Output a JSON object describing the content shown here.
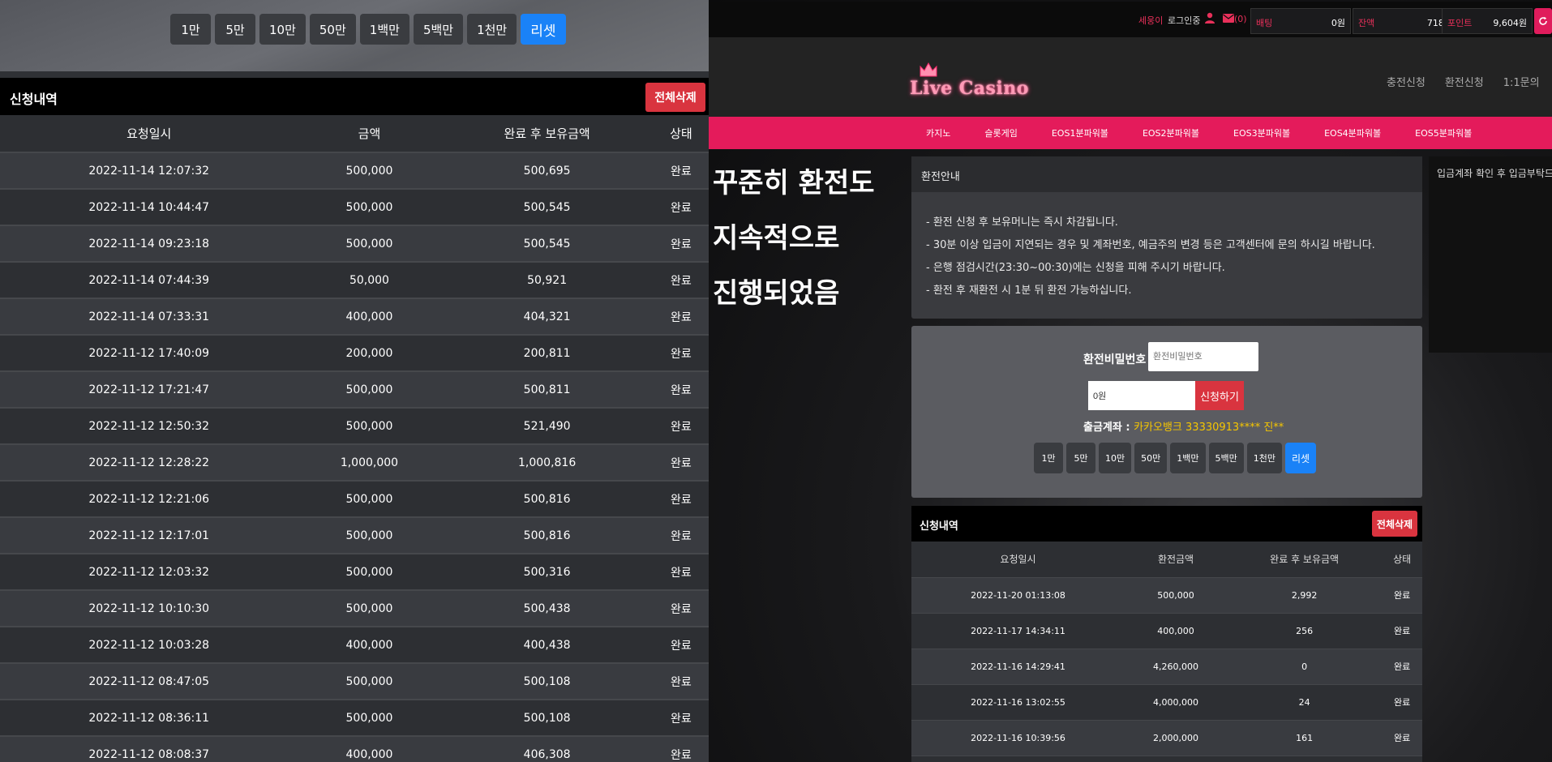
{
  "left": {
    "chips": [
      "1만",
      "5만",
      "10만",
      "50만",
      "1백만",
      "5백만",
      "1천만"
    ],
    "reset_label": "리셋",
    "history_title": "신청내역",
    "delete_all_label": "전체삭제",
    "columns": [
      "요청일시",
      "금액",
      "완료 후 보유금액",
      "상태"
    ],
    "rows": [
      [
        "2022-11-14 12:07:32",
        "500,000",
        "500,695",
        "완료"
      ],
      [
        "2022-11-14 10:44:47",
        "500,000",
        "500,545",
        "완료"
      ],
      [
        "2022-11-14 09:23:18",
        "500,000",
        "500,545",
        "완료"
      ],
      [
        "2022-11-14 07:44:39",
        "50,000",
        "50,921",
        "완료"
      ],
      [
        "2022-11-14 07:33:31",
        "400,000",
        "404,321",
        "완료"
      ],
      [
        "2022-11-12 17:40:09",
        "200,000",
        "200,811",
        "완료"
      ],
      [
        "2022-11-12 17:21:47",
        "500,000",
        "500,811",
        "완료"
      ],
      [
        "2022-11-12 12:50:32",
        "500,000",
        "521,490",
        "완료"
      ],
      [
        "2022-11-12 12:28:22",
        "1,000,000",
        "1,000,816",
        "완료"
      ],
      [
        "2022-11-12 12:21:06",
        "500,000",
        "500,816",
        "완료"
      ],
      [
        "2022-11-12 12:17:01",
        "500,000",
        "500,816",
        "완료"
      ],
      [
        "2022-11-12 12:03:32",
        "500,000",
        "500,316",
        "완료"
      ],
      [
        "2022-11-12 10:10:30",
        "500,000",
        "500,438",
        "완료"
      ],
      [
        "2022-11-12 10:03:28",
        "400,000",
        "400,438",
        "완료"
      ],
      [
        "2022-11-12 08:47:05",
        "500,000",
        "500,108",
        "완료"
      ],
      [
        "2022-11-12 08:36:11",
        "500,000",
        "500,108",
        "완료"
      ],
      [
        "2022-11-12 08:08:37",
        "400,000",
        "406,308",
        "완료"
      ]
    ]
  },
  "right": {
    "user": {
      "name": "세웅이",
      "login_label": "로그인중",
      "mail_count": "(0)"
    },
    "stats": [
      {
        "label": "배팅",
        "value": "0원"
      },
      {
        "label": "잔액",
        "value": "718원"
      },
      {
        "label": "포인트",
        "value": "9,604원"
      }
    ],
    "logo_text": "Live Casino",
    "header_links": [
      "충전신청",
      "환전신청",
      "1:1문의"
    ],
    "nav": [
      "카지노",
      "슬롯게임",
      "EOS1분파워볼",
      "EOS2분파워볼",
      "EOS3분파워볼",
      "EOS4분파워볼",
      "EOS5분파워볼"
    ],
    "overlay_lines": [
      "꾸준히 환전도",
      "지속적으로",
      "진행되었음"
    ],
    "info": {
      "title": "환전안내",
      "lines": [
        "- 환전 신청 후 보유머니는 즉시 차감됩니다.",
        "- 30분 이상 입금이 지연되는 경우 및 계좌번호, 예금주의 변경 등은 고객센터에 문의 하시길 바랍니다.",
        "- 은행 점검시간(23:30~00:30)에는 신청을 피해 주시기 바랍니다.",
        "- 환전 후 재환전 시 1분 뒤 환전 가능하십니다."
      ]
    },
    "side_text": "입금계좌 확인 후 입금부탁드",
    "form": {
      "pw_label": "환전비밀번호 :",
      "pw_placeholder": "환전비밀번호",
      "amount_value": "0원",
      "apply_label": "신청하기",
      "account_label": "출금계좌 : ",
      "account_value": "카카오뱅크 33330913**** 진**",
      "chips": [
        "1만",
        "5만",
        "10만",
        "50만",
        "1백만",
        "5백만",
        "1천만"
      ],
      "reset_label": "리셋"
    },
    "history": {
      "title": "신청내역",
      "delete_all_label": "전체삭제",
      "columns": [
        "요청일시",
        "환전금액",
        "완료 후 보유금액",
        "상태"
      ],
      "rows": [
        [
          "2022-11-20 01:13:08",
          "500,000",
          "2,992",
          "완료"
        ],
        [
          "2022-11-17 14:34:11",
          "400,000",
          "256",
          "완료"
        ],
        [
          "2022-11-16 14:29:41",
          "4,260,000",
          "0",
          "완료"
        ],
        [
          "2022-11-16 13:02:55",
          "4,000,000",
          "24",
          "완료"
        ],
        [
          "2022-11-16 10:39:56",
          "2,000,000",
          "161",
          "완료"
        ]
      ]
    },
    "colors": {
      "accent": "#e41b5b",
      "danger": "#d9343f",
      "primary": "#1a82f7",
      "account": "#f6c600"
    }
  }
}
